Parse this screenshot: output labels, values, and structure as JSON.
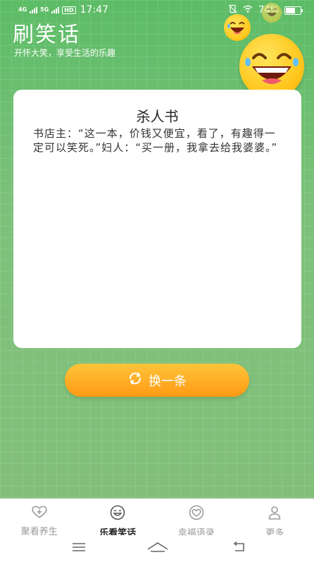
{
  "status_bar": {
    "signal_1_label": "4G",
    "signal_2_label": "5G",
    "hd_label": "HD",
    "time": "17:47",
    "battery": "74%",
    "battery_level": 0.74
  },
  "header": {
    "title": "刷笑话",
    "subtitle": "开怀大笑，享受生活的乐趣"
  },
  "joke": {
    "title": "杀人书",
    "content": "书店主：“这一本，价钱又便宜，看了，有趣得一定可以笑死。”妇人：“买一册，我拿去给我婆婆。”"
  },
  "refresh_button": {
    "label": "换一条",
    "icon": "refresh-icon"
  },
  "tabs": [
    {
      "label": "聚看养生",
      "icon": "heart-plus-icon",
      "active": false
    },
    {
      "label": "乐看笑话",
      "icon": "laughing-face-icon",
      "active": true
    },
    {
      "label": "幸福语录",
      "icon": "heart-circle-icon",
      "active": false
    },
    {
      "label": "更多",
      "icon": "user-icon",
      "active": false
    }
  ],
  "colors": {
    "background": "#7cbf6f",
    "button_gradient_top": "#ffc43a",
    "button_gradient_bottom": "#ff9a14",
    "tab_active": "#222222",
    "tab_inactive": "#9a9a9a"
  }
}
